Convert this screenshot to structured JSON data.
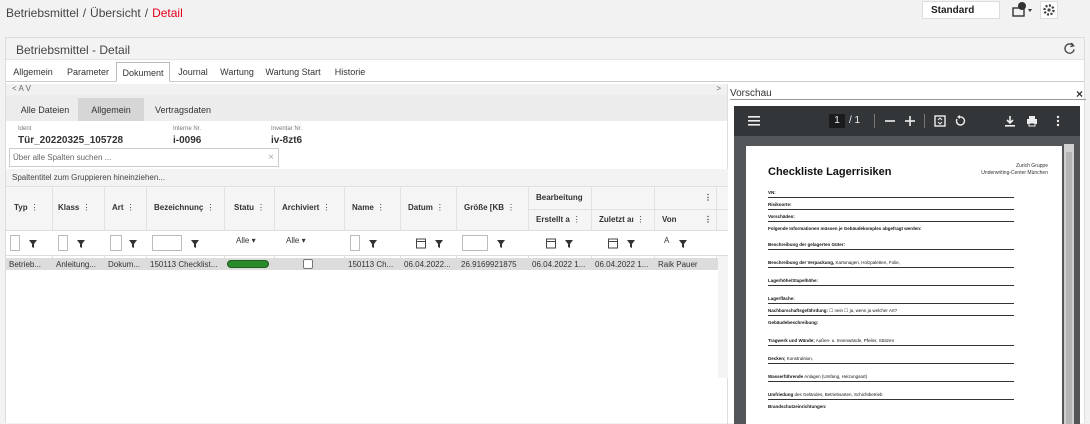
{
  "breadcrumb": [
    "Betriebsmittel",
    "Übersicht",
    "Detail"
  ],
  "header_controls": {
    "layout_select": "Standard"
  },
  "panel": {
    "title": "Betriebsmittel - Detail"
  },
  "tabs": [
    {
      "label": "Allgemein"
    },
    {
      "label": "Parameter"
    },
    {
      "label": "Dokument",
      "active": true
    },
    {
      "label": "Journal"
    },
    {
      "label": "Wartung"
    },
    {
      "label": "Wartung Start"
    },
    {
      "label": "Historie"
    }
  ],
  "nav_strip": {
    "left": "<  A  V",
    "right": ">"
  },
  "subtabs": [
    {
      "label": "Alle Dateien"
    },
    {
      "label": "Allgemein",
      "active": true
    },
    {
      "label": "Vertragsdaten"
    }
  ],
  "meta": [
    {
      "label": "Ident",
      "value": "Tür_20220325_105728"
    },
    {
      "label": "Interne Nr.",
      "value": "i-0096"
    },
    {
      "label": "Inventar Nr.",
      "value": "iv-8zt6"
    }
  ],
  "search": {
    "placeholder": "Über alle Spalten suchen ...",
    "clear": "×"
  },
  "group_hint": "Spaltentitel zum Gruppieren hineinziehen...",
  "table": {
    "columns": [
      "Typ",
      "Klass",
      "Art",
      "Bezeichnunç",
      "Statu",
      "Archiviert",
      "Name",
      "Datum",
      "Größe [KB"
    ],
    "group_header": "Bearbeitung",
    "sub_columns": [
      "Erstellt a",
      "Zuletzt aı",
      "Von"
    ],
    "menu_glyph": "⋮",
    "filter_all": "Alle",
    "filter_von": "A",
    "row": {
      "typ": "Betrieb...",
      "klasse": "Anleitung...",
      "art": "Dokum...",
      "bezeichnung": "150113 Checklist...",
      "name": "150113 Ch...",
      "datum": "06.04.2022...",
      "groesse": "26.9169921875",
      "erstellt": "06.04.2022 1...",
      "zuletzt": "06.04.2022 1...",
      "von": "Raik Pauer",
      "status_color": "#2c8a2c"
    }
  },
  "preview": {
    "title": "Vorschau",
    "close": "×",
    "page_current": "1",
    "page_total": "/ 1",
    "doc": {
      "title": "Checkliste Lagerrisiken",
      "company": [
        "Zurich Gruppe",
        "Underwriting-Center München"
      ],
      "lines": [
        {
          "label": "VN:"
        },
        {
          "label": "Risikoorte:"
        },
        {
          "label": "Vorschäden:"
        },
        {
          "label": "Folgende Informationen müssen je Gebäudekomplex abgefragt werden:"
        },
        {
          "label": "Beschreibung der gelagerten Güter:"
        },
        {
          "label": "Beschreibung der Verpackung,",
          "note": " Kartonagen, Holzpaletten, Folie,"
        },
        {
          "label": "Lagerhöhe/Stapelhöhe:"
        },
        {
          "label": "Lagerfläche:"
        },
        {
          "label": "Nachbarschaftsgefährdung:",
          "note": " ☐ nein   ☐ ja, wenn ja welcher Art?"
        },
        {
          "label": "Gebäudebeschreibung:"
        },
        {
          "label": "Tragwerk und Wände;",
          "note": " Außen- u. Innenwände, Pfeiler, Stützen"
        },
        {
          "label": "Decken;",
          "note": " Konstruktion,"
        },
        {
          "label": "Wasserführende",
          "note": " Anlagen (Umfang, Heizungsart)"
        },
        {
          "label": "Umfriedung",
          "note": " des Geländes, Betriebsarten, Schichtbetrieb"
        },
        {
          "label": "Brandschutzeinrichtungen:"
        }
      ]
    }
  }
}
